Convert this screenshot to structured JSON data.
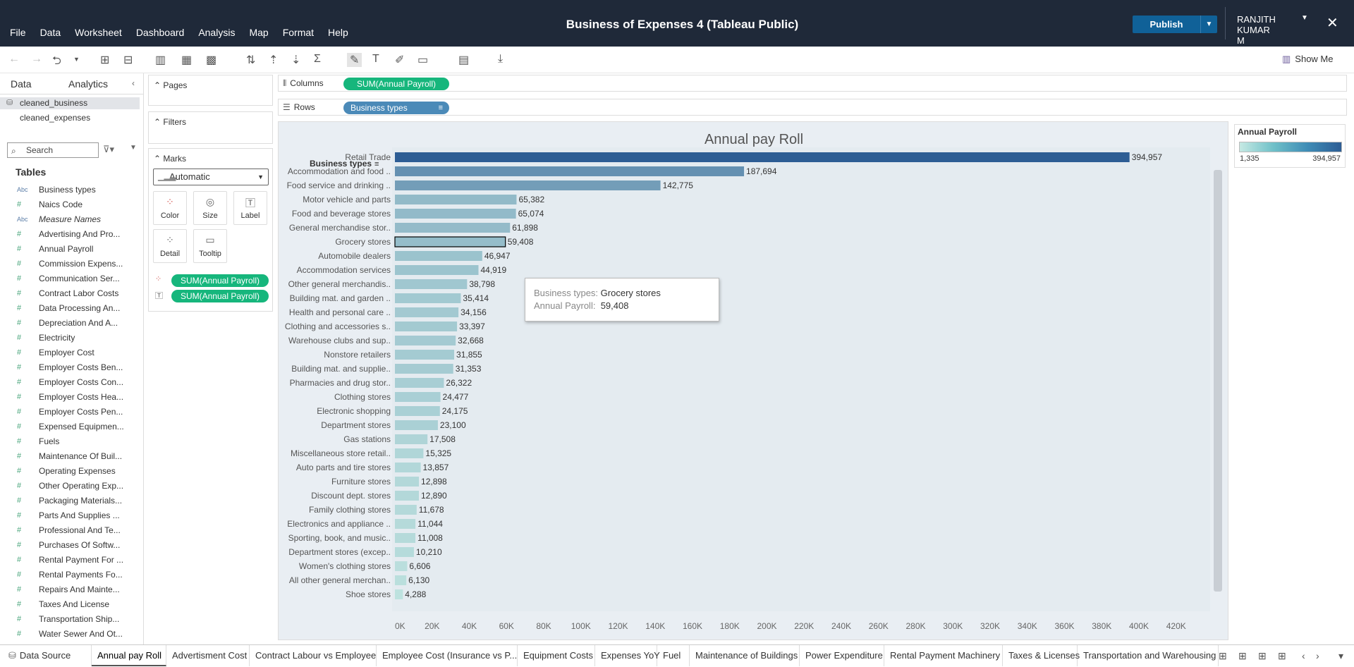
{
  "menu": {
    "file": "File",
    "data": "Data",
    "worksheet": "Worksheet",
    "dashboard": "Dashboard",
    "analysis": "Analysis",
    "map": "Map",
    "format": "Format",
    "help": "Help"
  },
  "window_title": "Business of Expenses 4 (Tableau Public)",
  "publish": "Publish",
  "user": "RANJITH KUMAR M",
  "toolbar": {
    "show_me": "Show Me"
  },
  "left": {
    "tab_data": "Data",
    "tab_analytics": "Analytics",
    "datasources": [
      "cleaned_business",
      "cleaned_expenses"
    ],
    "search_placeholder": "Search",
    "tables_heading": "Tables",
    "fields": [
      {
        "name": "Business types",
        "type": "Abc",
        "italic": false
      },
      {
        "name": "Naics Code",
        "type": "#",
        "italic": false
      },
      {
        "name": "Measure Names",
        "type": "Abc",
        "italic": true
      },
      {
        "name": "Advertising And Pro...",
        "type": "#",
        "italic": false
      },
      {
        "name": "Annual Payroll",
        "type": "#",
        "italic": false
      },
      {
        "name": "Commission Expens...",
        "type": "#",
        "italic": false
      },
      {
        "name": "Communication Ser...",
        "type": "#",
        "italic": false
      },
      {
        "name": "Contract Labor Costs",
        "type": "#",
        "italic": false
      },
      {
        "name": "Data Processing An...",
        "type": "#",
        "italic": false
      },
      {
        "name": "Depreciation And A...",
        "type": "#",
        "italic": false
      },
      {
        "name": "Electricity",
        "type": "#",
        "italic": false
      },
      {
        "name": "Employer Cost",
        "type": "#",
        "italic": false
      },
      {
        "name": "Employer Costs Ben...",
        "type": "#",
        "italic": false
      },
      {
        "name": "Employer Costs Con...",
        "type": "#",
        "italic": false
      },
      {
        "name": "Employer Costs Hea...",
        "type": "#",
        "italic": false
      },
      {
        "name": "Employer Costs Pen...",
        "type": "#",
        "italic": false
      },
      {
        "name": "Expensed Equipmen...",
        "type": "#",
        "italic": false
      },
      {
        "name": "Fuels",
        "type": "#",
        "italic": false
      },
      {
        "name": "Maintenance Of Buil...",
        "type": "#",
        "italic": false
      },
      {
        "name": "Operating Expenses",
        "type": "#",
        "italic": false
      },
      {
        "name": "Other Operating Exp...",
        "type": "#",
        "italic": false
      },
      {
        "name": "Packaging Materials...",
        "type": "#",
        "italic": false
      },
      {
        "name": "Parts And Supplies ...",
        "type": "#",
        "italic": false
      },
      {
        "name": "Professional And Te...",
        "type": "#",
        "italic": false
      },
      {
        "name": "Purchases Of Softw...",
        "type": "#",
        "italic": false
      },
      {
        "name": "Rental Payment For ...",
        "type": "#",
        "italic": false
      },
      {
        "name": "Rental Payments Fo...",
        "type": "#",
        "italic": false
      },
      {
        "name": "Repairs And Mainte...",
        "type": "#",
        "italic": false
      },
      {
        "name": "Taxes And License",
        "type": "#",
        "italic": false
      },
      {
        "name": "Transportation Ship...",
        "type": "#",
        "italic": false
      },
      {
        "name": "Water Sewer And Ot...",
        "type": "#",
        "italic": false
      }
    ]
  },
  "cards": {
    "pages": "Pages",
    "filters": "Filters",
    "marks": "Marks",
    "mark_type": "Automatic",
    "color": "Color",
    "size": "Size",
    "label": "Label",
    "detail": "Detail",
    "tooltip": "Tooltip",
    "pill1": "SUM(Annual Payroll)",
    "pill2": "SUM(Annual Payroll)"
  },
  "shelves": {
    "columns_label": "Columns",
    "rows_label": "Rows",
    "columns_pill": "SUM(Annual Payroll)",
    "rows_pill": "Business types"
  },
  "legend": {
    "title": "Annual Payroll",
    "min": "1,335",
    "max": "394,957"
  },
  "tooltip": {
    "k1": "Business types:",
    "v1": "Grocery stores",
    "k2": "Annual Payroll:",
    "v2": "59,408"
  },
  "sheet_tabs": [
    "Data Source",
    "Annual pay Roll",
    "Advertisment Cost",
    "Contract Labour vs Employee",
    "Employee Cost (Insurance vs P...",
    "Equipment Costs",
    "Expenses YoY",
    "Fuel",
    "Maintenance of Buildings",
    "Power Expenditure",
    "Rental Payment Machinery",
    "Taxes & Licenses",
    "Transportation and Warehousing"
  ],
  "colors": {
    "bar_dark": "#2d5d94",
    "bar_light": "#c5e9e3",
    "highlight_outline": "#000000",
    "accent_green": "#16b67c",
    "pill_blue": "#4b8ab8",
    "publish": "#106198"
  },
  "chart_data": {
    "type": "bar",
    "title": "Annual pay Roll",
    "row_header": "Business types",
    "selected": "Grocery stores",
    "categories": [
      "Retail Trade",
      "Accommodation and food ..",
      "Food service and drinking ..",
      "Motor vehicle and parts",
      "Food and beverage stores",
      "General merchandise stor..",
      "Grocery stores",
      "Automobile dealers",
      "Accommodation services",
      "Other general merchandis..",
      "Building mat. and garden ..",
      "Health and personal care ..",
      "Clothing and accessories s..",
      "Warehouse clubs and sup..",
      "Nonstore retailers",
      "Building mat. and supplie..",
      "Pharmacies and drug stor..",
      "Clothing stores",
      "Electronic shopping",
      "Department stores",
      "Gas stations",
      "Miscellaneous store retail..",
      "Auto parts and tire stores",
      "Furniture stores",
      "Discount dept. stores",
      "Family clothing stores",
      "Electronics and appliance ..",
      "Sporting, book, and  music..",
      "Department stores (excep..",
      "Women's clothing stores",
      "All other general merchan..",
      "Shoe stores"
    ],
    "values": [
      394957,
      187694,
      142775,
      65382,
      65074,
      61898,
      59408,
      46947,
      44919,
      38798,
      35414,
      34156,
      33397,
      32668,
      31855,
      31353,
      26322,
      24477,
      24175,
      23100,
      17508,
      15325,
      13857,
      12898,
      12890,
      11678,
      11044,
      11008,
      10210,
      6606,
      6130,
      4288
    ],
    "labels": [
      "394,957",
      "187,694",
      "142,775",
      "65,382",
      "65,074",
      "61,898",
      "59,408",
      "46,947",
      "44,919",
      "38,798",
      "35,414",
      "34,156",
      "33,397",
      "32,668",
      "31,855",
      "31,353",
      "26,322",
      "24,477",
      "24,175",
      "23,100",
      "17,508",
      "15,325",
      "13,857",
      "12,898",
      "12,890",
      "11,678",
      "11,044",
      "11,008",
      "10,210",
      "6,606",
      "6,130",
      "4,288"
    ],
    "xticks": [
      "0K",
      "20K",
      "40K",
      "60K",
      "80K",
      "100K",
      "120K",
      "140K",
      "160K",
      "180K",
      "200K",
      "220K",
      "240K",
      "260K",
      "280K",
      "300K",
      "320K",
      "340K",
      "360K",
      "380K",
      "400K",
      "420K"
    ],
    "xlim": [
      0,
      420000
    ],
    "color_range": [
      1335,
      394957
    ]
  }
}
